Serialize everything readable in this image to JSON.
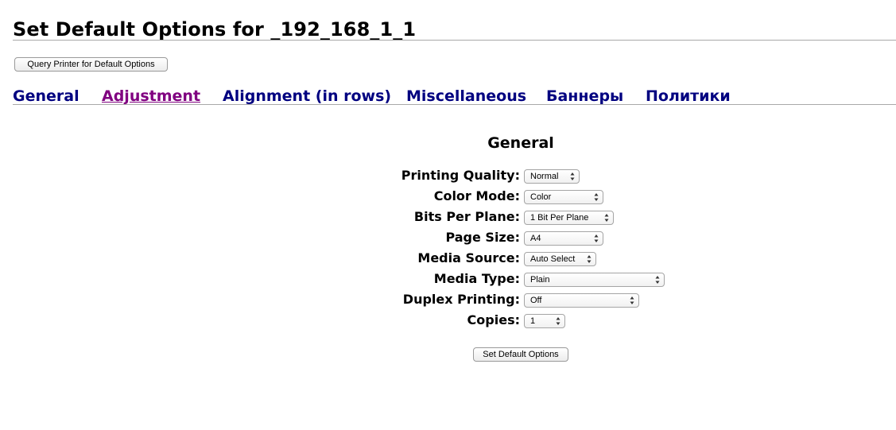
{
  "page": {
    "title": "Set Default Options for _192_168_1_1"
  },
  "toolbar": {
    "query_button": "Query Printer for Default Options"
  },
  "tabs": [
    {
      "label": "General"
    },
    {
      "label": "Adjustment"
    },
    {
      "label": "Alignment (in rows)"
    },
    {
      "label": "Miscellaneous"
    },
    {
      "label": "Баннеры"
    },
    {
      "label": "Политики"
    }
  ],
  "section": {
    "title": "General"
  },
  "options": [
    {
      "label": "Printing Quality:",
      "value": "Normal"
    },
    {
      "label": "Color Mode:",
      "value": "Color"
    },
    {
      "label": "Bits Per Plane:",
      "value": "1 Bit Per Plane"
    },
    {
      "label": "Page Size:",
      "value": "A4"
    },
    {
      "label": "Media Source:",
      "value": "Auto Select"
    },
    {
      "label": "Media Type:",
      "value": "Plain"
    },
    {
      "label": "Duplex Printing:",
      "value": "Off"
    },
    {
      "label": "Copies:",
      "value": "1"
    }
  ],
  "form": {
    "submit_label": "Set Default Options"
  },
  "colors": {
    "tab_link": "#000080",
    "tab_visited": "#800080",
    "rule": "#a9a9a9"
  }
}
